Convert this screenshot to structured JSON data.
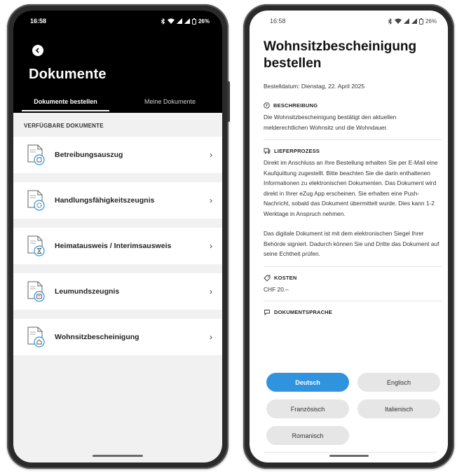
{
  "left": {
    "status": {
      "time": "16:58",
      "battery": "26%"
    },
    "title": "Dokumente",
    "tabs": [
      {
        "label": "Dokumente bestellen",
        "active": true
      },
      {
        "label": "Meine Dokumente",
        "active": false
      }
    ],
    "section_label": "VERFÜGBARE DOKUMENTE",
    "documents": [
      {
        "label": "Betreibungsauszug",
        "icon": "document-coin-icon"
      },
      {
        "label": "Handlungsfähigkeitszeugnis",
        "icon": "document-gear-icon"
      },
      {
        "label": "Heimatausweis / Interimsausweis",
        "icon": "document-hourglass-icon"
      },
      {
        "label": "Leumundszeugnis",
        "icon": "document-id-icon"
      },
      {
        "label": "Wohnsitzbescheinigung",
        "icon": "document-house-icon"
      }
    ]
  },
  "right": {
    "status": {
      "time": "16:58",
      "battery": "26%"
    },
    "title_line1": "Wohnsitzbescheinigung",
    "title_line2": "bestellen",
    "order_date": "Bestelldatum: Dienstag, 22. April 2025",
    "description": {
      "heading": "BESCHREIBUNG",
      "text": "Die Wohnsitzbescheinigung bestätigt den aktuellen melderechtlichen Wohnsitz und die Wohndauer."
    },
    "delivery": {
      "heading": "LIEFERPROZESS",
      "text1": "Direkt im Anschluss an Ihre Bestellung erhalten Sie per E-Mail eine Kaufquittung zugestellt. Bitte beachten Sie die darin enthaltenen Informationen zu elektronischen Dokumenten. Das Dokument wird direkt in Ihrer eZug App erscheinen. Sie erhalten eine Push-Nachricht, sobald das Dokument übermittelt wurde. Dies kann 1-2 Werktage in Anspruch nehmen.",
      "text2": "Das digitale Dokument ist mit dem elektronischen Siegel Ihrer Behörde signiert. Dadurch können Sie und Dritte das Dokument auf seine Echtheit prüfen."
    },
    "costs": {
      "heading": "KOSTEN",
      "value": "CHF 20.–"
    },
    "language": {
      "heading": "DOKUMENTSPRACHE",
      "options": [
        {
          "label": "Deutsch",
          "selected": true
        },
        {
          "label": "Englisch",
          "selected": false
        },
        {
          "label": "Französisch",
          "selected": false
        },
        {
          "label": "Italienisch",
          "selected": false
        },
        {
          "label": "Romanisch",
          "selected": false
        }
      ]
    }
  },
  "colors": {
    "accent": "#2f94dd",
    "header": "#000000",
    "list_bg": "#f1f1f1"
  }
}
